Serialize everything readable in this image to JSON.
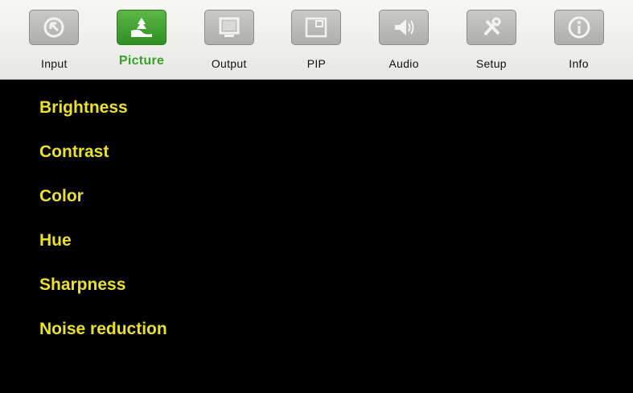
{
  "tabs": [
    {
      "label": "Input",
      "icon": "input-arrow-icon"
    },
    {
      "label": "Picture",
      "icon": "picture-landscape-icon",
      "active": true
    },
    {
      "label": "Output",
      "icon": "monitor-icon"
    },
    {
      "label": "PIP",
      "icon": "pip-icon"
    },
    {
      "label": "Audio",
      "icon": "speaker-icon"
    },
    {
      "label": "Setup",
      "icon": "tools-icon"
    },
    {
      "label": "Info",
      "icon": "info-icon"
    }
  ],
  "menu": {
    "items": [
      "Brightness",
      "Contrast",
      "Color",
      "Hue",
      "Sharpness",
      "Noise reduction"
    ]
  },
  "colors": {
    "active_tab": "#37a02a",
    "menu_text": "#e9e02f",
    "background": "#000000"
  }
}
